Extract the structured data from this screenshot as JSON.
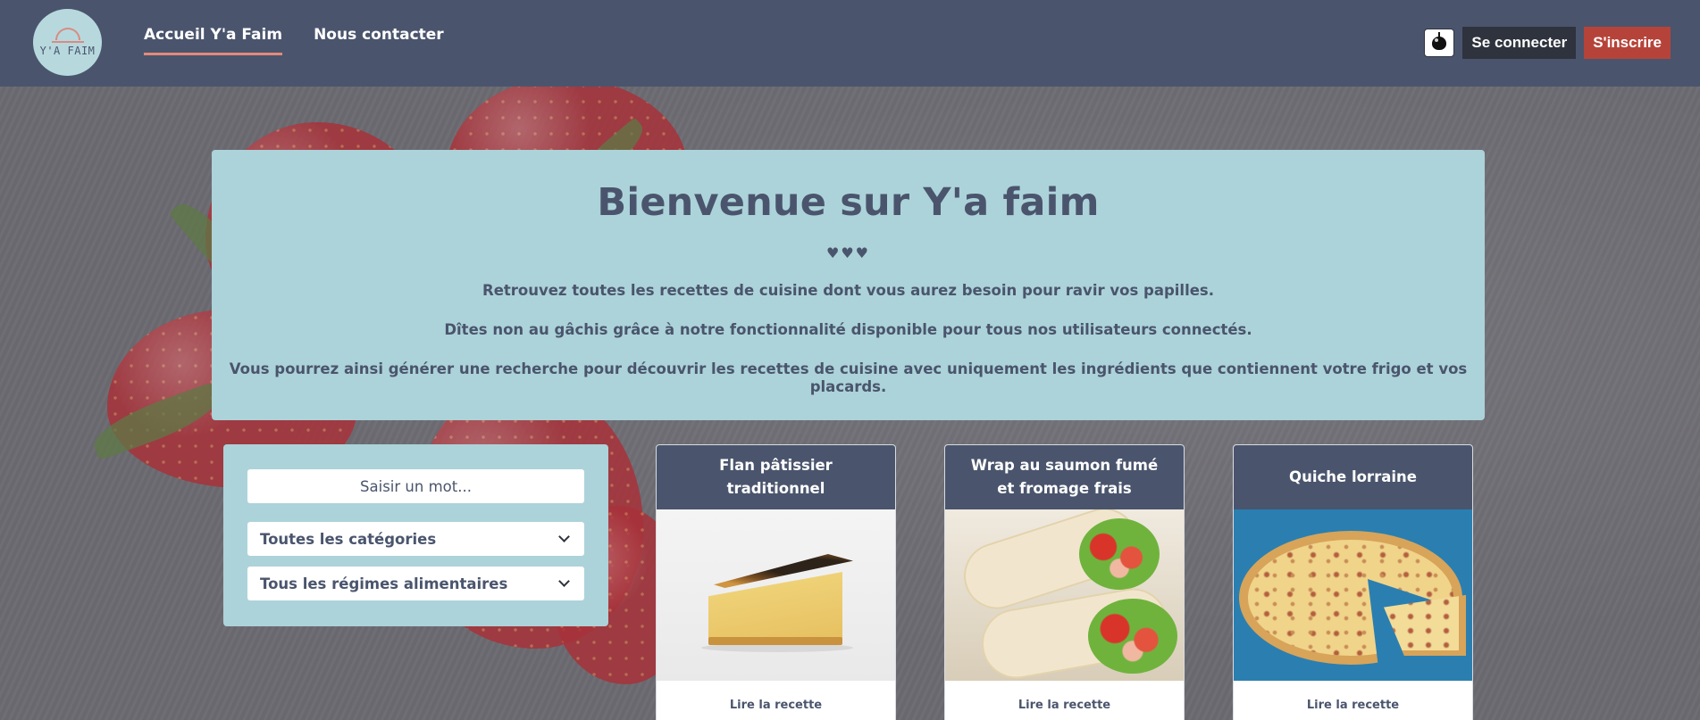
{
  "brand": {
    "logo_text": "Y'A FAIM"
  },
  "nav": {
    "items": [
      {
        "label": "Accueil Y'a Faim"
      },
      {
        "label": "Nous contacter"
      }
    ]
  },
  "header": {
    "login_label": "Se connecter",
    "signup_label": "S'inscrire"
  },
  "hero": {
    "title": "Bienvenue sur Y'a faim",
    "hearts": "♥♥♥",
    "paragraphs": [
      "Retrouvez toutes les recettes de cuisine dont vous aurez besoin pour ravir vos papilles.",
      "Dîtes non au gâchis grâce à notre fonctionnalité disponible pour tous nos utilisateurs connectés.",
      "Vous pourrez ainsi générer une recherche pour découvrir les recettes de cuisine avec uniquement les ingrédients que contiennent votre frigo et vos placards."
    ]
  },
  "filters": {
    "search_placeholder": "Saisir un mot...",
    "category_selected": "Toutes les catégories",
    "diet_selected": "Tous les régimes alimentaires"
  },
  "recipes": [
    {
      "title": "Flan pâtissier traditionnel",
      "cta": "Lire la recette"
    },
    {
      "title": "Wrap au saumon fumé et fromage frais",
      "cta": "Lire la recette"
    },
    {
      "title": "Quiche lorraine",
      "cta": "Lire la recette"
    }
  ],
  "colors": {
    "header_bg": "#4a556d",
    "panel_bg": "#acd3d9",
    "signup_bg": "#b6433a",
    "login_bg": "#2f333d",
    "active_underline": "#e48a7a"
  }
}
